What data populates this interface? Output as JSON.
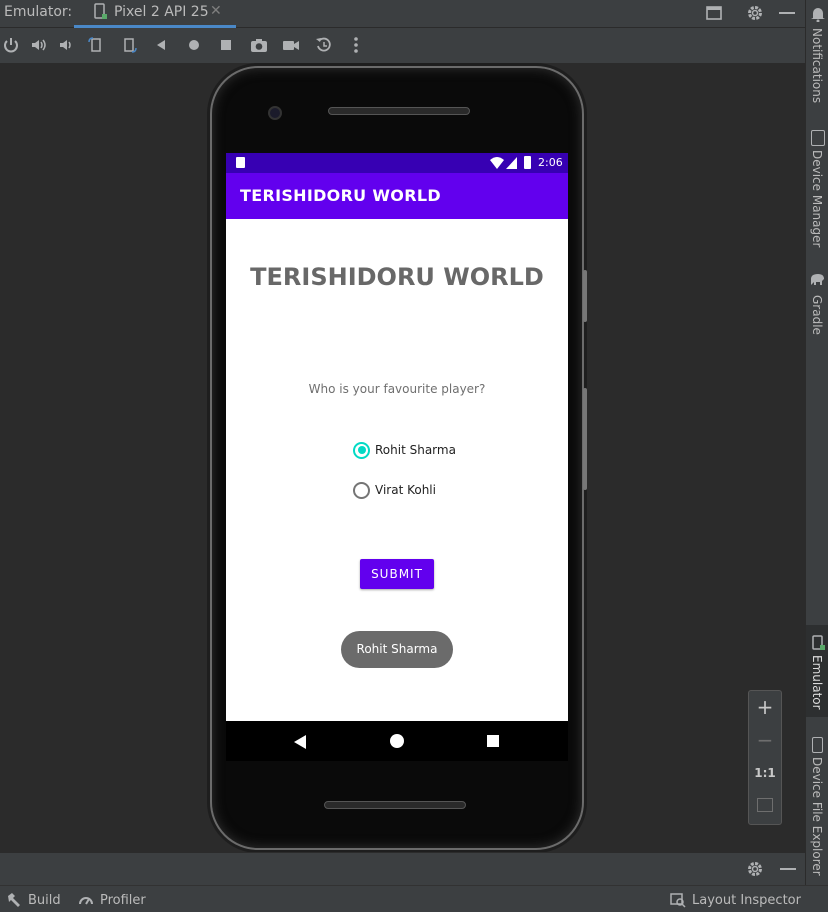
{
  "ide": {
    "emulator_label": "Emulator:",
    "device_tab": "Pixel 2 API 25",
    "right_tabs": [
      "Notifications",
      "Device Manager",
      "Gradle",
      "Emulator",
      "Device File Explorer"
    ],
    "bottom_left": [
      {
        "label": "Build",
        "icon": "hammer-icon"
      },
      {
        "label": "Profiler",
        "icon": "gauge-icon"
      }
    ],
    "bottom_right": "Layout Inspector",
    "zoom": {
      "plus": "+",
      "minus": "−",
      "actual": "1:1"
    }
  },
  "device": {
    "status_time": "2:06",
    "app_bar_title": "TERISHIDORU WORLD",
    "headline": "TERISHIDORU WORLD",
    "question": "Who is your favourite player?",
    "options": [
      {
        "label": "Rohit Sharma",
        "checked": true
      },
      {
        "label": "Virat Kohli",
        "checked": false
      }
    ],
    "submit_label": "SUBMIT",
    "toast_text": "Rohit Sharma"
  },
  "colors": {
    "primary": "#6200ee",
    "primary_dark": "#3700b3",
    "accent": "#03dac5"
  }
}
